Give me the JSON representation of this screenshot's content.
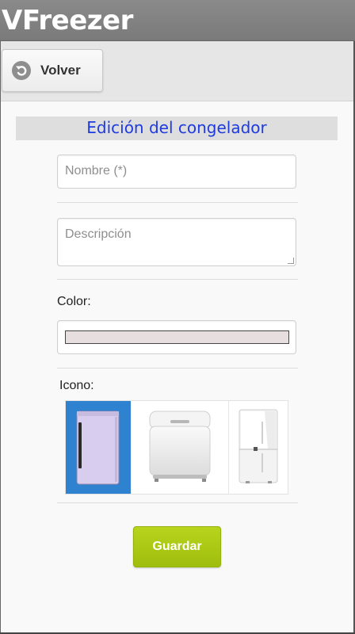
{
  "app": {
    "title": "VFreezer"
  },
  "toolbar": {
    "back_label": "Volver",
    "back_icon": "undo-arrow-icon"
  },
  "header": {
    "title": "Edición del congelador",
    "title_color": "#1f3be0"
  },
  "form": {
    "name_placeholder": "Nombre (*)",
    "description_placeholder": "Descripción",
    "color_label": "Color:",
    "color_value": "#e7dfdf",
    "icon_label": "Icono:",
    "icons": [
      {
        "name": "upright-freezer-icon",
        "selected": true
      },
      {
        "name": "chest-freezer-icon",
        "selected": false
      },
      {
        "name": "fridge-freezer-icon",
        "selected": false
      }
    ],
    "selected_color": "#2e82d0",
    "save_label": "Guardar",
    "save_color": "#a8c514"
  }
}
